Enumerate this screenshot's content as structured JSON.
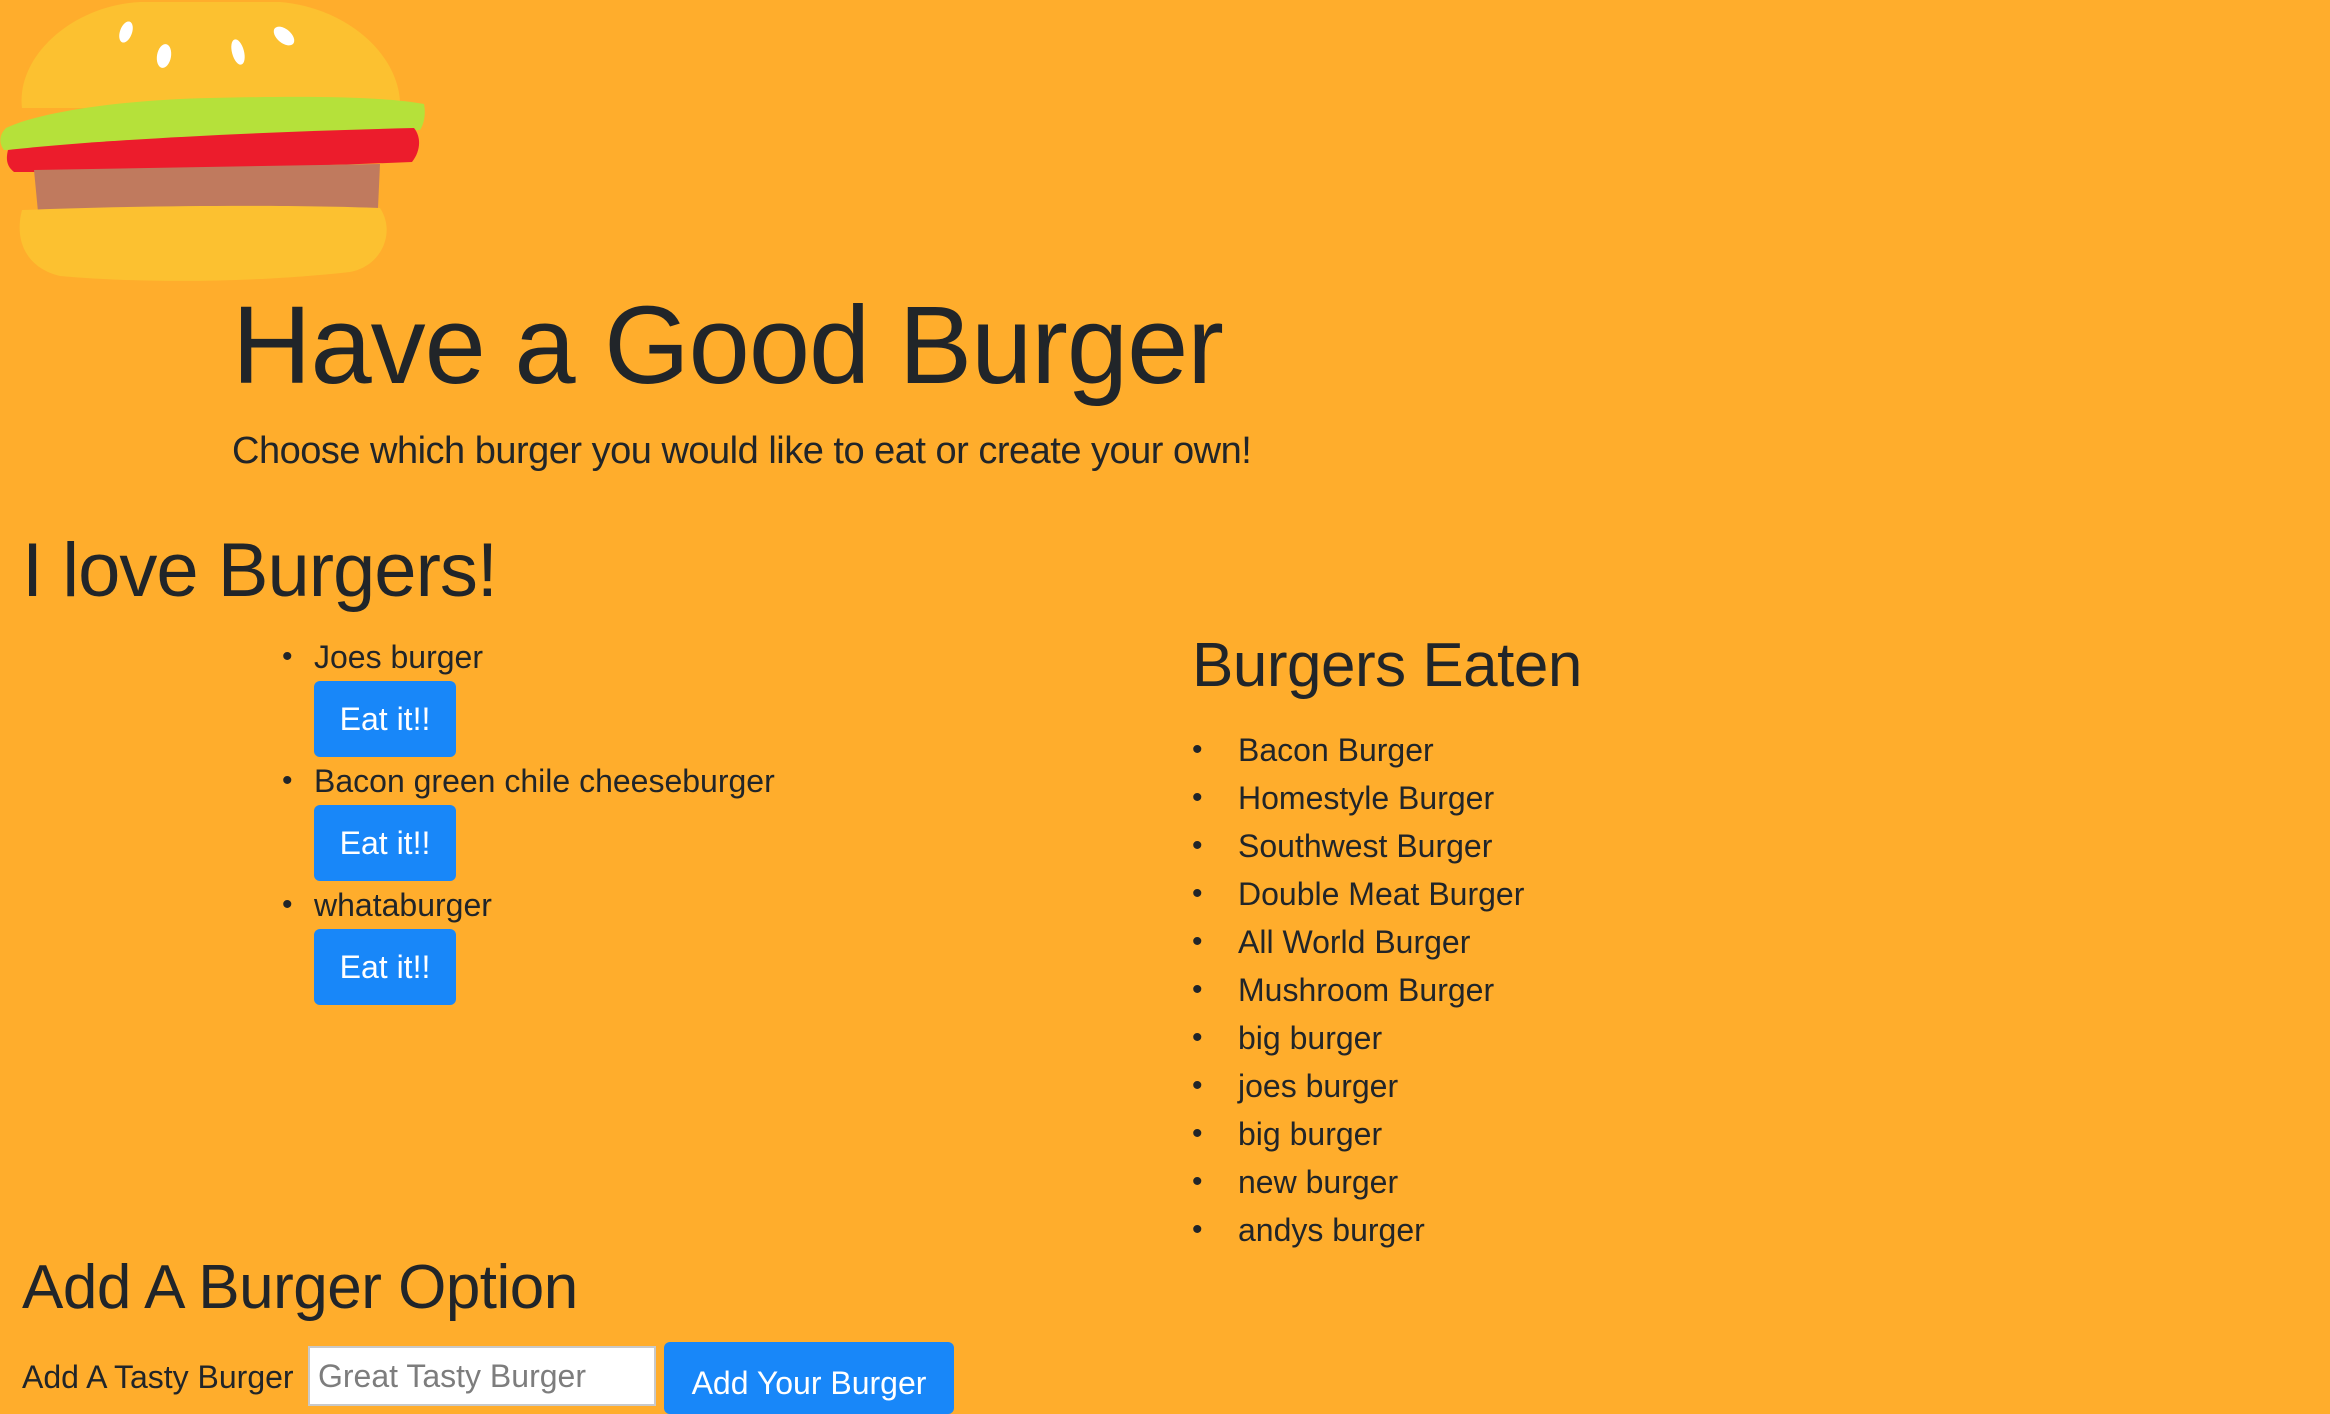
{
  "colors": {
    "page_background": "#ffad2c",
    "button_primary": "#1887f9",
    "text": "#212529",
    "bun": "#fcc130",
    "lettuce": "#b5e13a",
    "tomato": "#ec1c2c",
    "patty": "#c07a5e",
    "seeds": "#ffffff"
  },
  "logo": {
    "icon": "burger-icon"
  },
  "jumbotron": {
    "title": "Have a Good Burger",
    "lead": "Choose which burger you would like to eat or create your own!"
  },
  "menu": {
    "title": "I love Burgers!",
    "bullet": "•",
    "items": [
      {
        "name": "Joes burger",
        "button_label": "Eat it!!"
      },
      {
        "name": "Bacon green chile cheeseburger",
        "button_label": "Eat it!!"
      },
      {
        "name": "whataburger",
        "button_label": "Eat it!!"
      }
    ]
  },
  "eaten": {
    "title": "Burgers Eaten",
    "bullet": "•",
    "items": [
      "Bacon Burger",
      "Homestyle Burger",
      "Southwest Burger",
      "Double Meat Burger",
      "All World Burger",
      "Mushroom Burger",
      "big burger",
      "joes burger",
      "big burger",
      "new burger",
      "andys burger"
    ]
  },
  "add_form": {
    "title": "Add A Burger Option",
    "label": "Add A Tasty Burger",
    "input_value": "",
    "input_placeholder": "Great Tasty Burger",
    "button_label": "Add Your Burger"
  }
}
